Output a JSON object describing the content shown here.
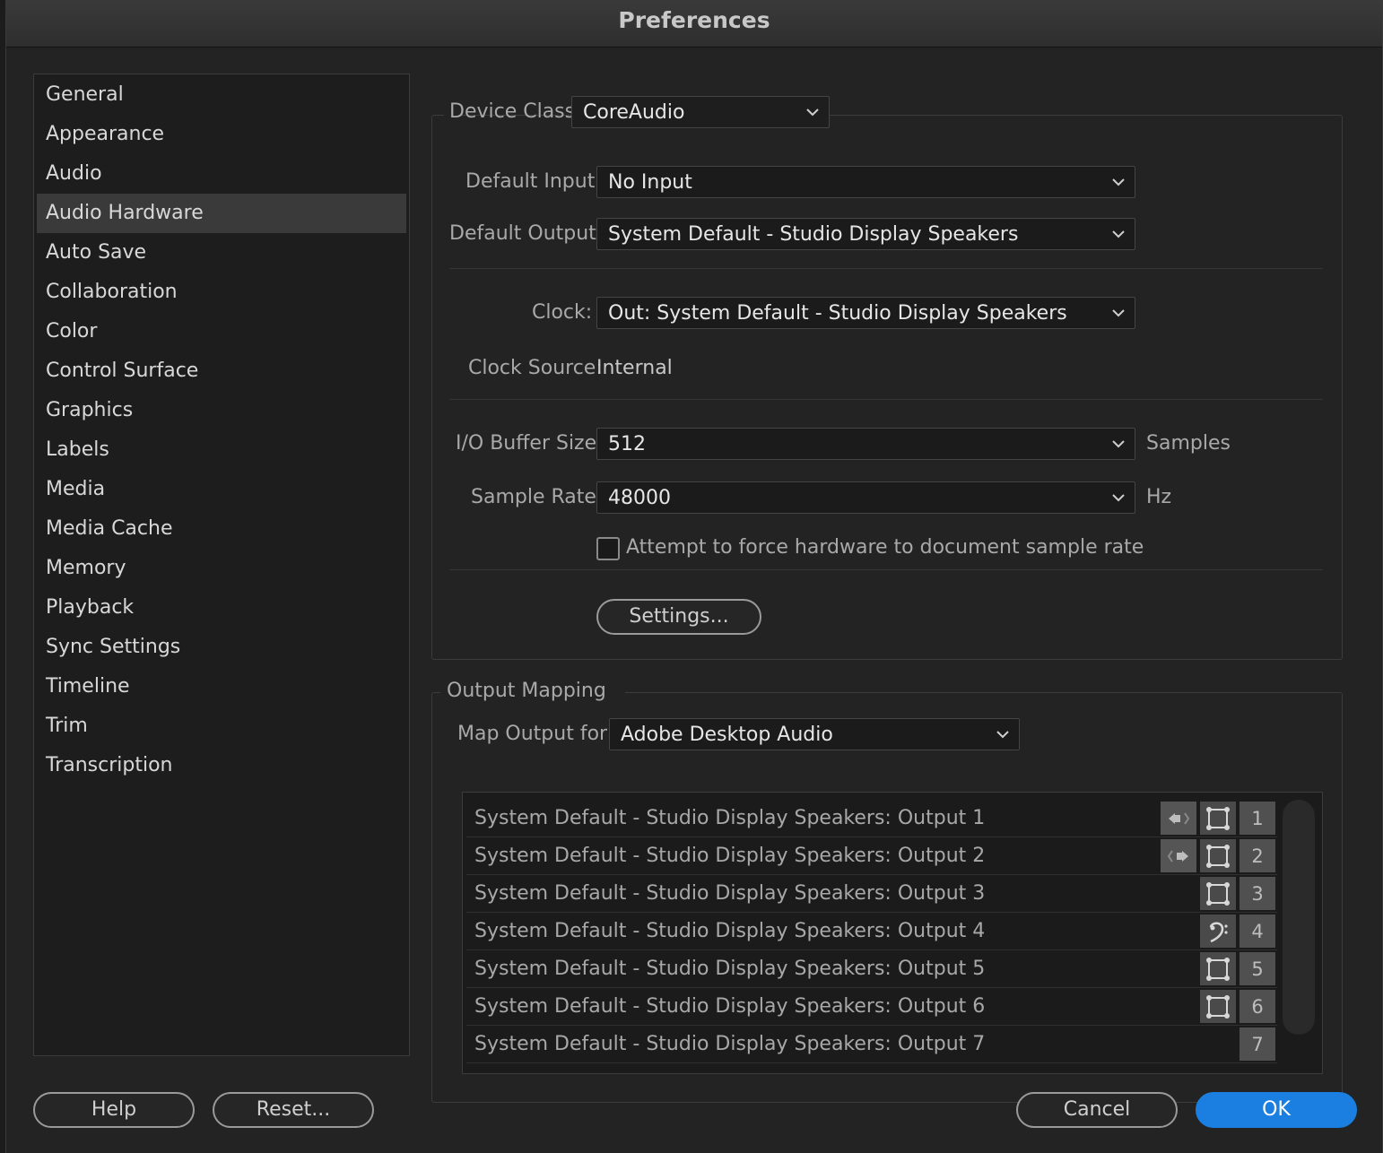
{
  "window": {
    "title": "Preferences"
  },
  "sidebar": {
    "items": [
      {
        "label": "General"
      },
      {
        "label": "Appearance"
      },
      {
        "label": "Audio"
      },
      {
        "label": "Audio Hardware",
        "selected": true
      },
      {
        "label": "Auto Save"
      },
      {
        "label": "Collaboration"
      },
      {
        "label": "Color"
      },
      {
        "label": "Control Surface"
      },
      {
        "label": "Graphics"
      },
      {
        "label": "Labels"
      },
      {
        "label": "Media"
      },
      {
        "label": "Media Cache"
      },
      {
        "label": "Memory"
      },
      {
        "label": "Playback"
      },
      {
        "label": "Sync Settings"
      },
      {
        "label": "Timeline"
      },
      {
        "label": "Trim"
      },
      {
        "label": "Transcription"
      }
    ]
  },
  "device": {
    "class_label": "Device Class:",
    "class_value": "CoreAudio",
    "default_input_label": "Default Input:",
    "default_input_value": "No Input",
    "default_output_label": "Default Output:",
    "default_output_value": "System Default - Studio Display Speakers",
    "clock_label": "Clock:",
    "clock_value": "Out: System Default - Studio Display Speakers",
    "clock_source_label": "Clock Source:",
    "clock_source_value": "Internal",
    "buffer_label": "I/O Buffer Size:",
    "buffer_value": "512",
    "buffer_unit": "Samples",
    "rate_label": "Sample Rate:",
    "rate_value": "48000",
    "rate_unit": "Hz",
    "force_rate_label": "Attempt to force hardware to document sample rate",
    "force_rate_checked": false,
    "settings_button": "Settings..."
  },
  "output_mapping": {
    "title": "Output Mapping",
    "map_for_label": "Map Output for:",
    "map_for_value": "Adobe Desktop Audio",
    "rows": [
      {
        "label": "System Default - Studio Display Speakers: Output 1",
        "channel": "1",
        "speaker_icon": "left-speaker-icon",
        "mono_icon": "mono-speaker-icon"
      },
      {
        "label": "System Default - Studio Display Speakers: Output 2",
        "channel": "2",
        "speaker_icon": "right-speaker-icon",
        "mono_icon": "mono-speaker-icon"
      },
      {
        "label": "System Default - Studio Display Speakers: Output 3",
        "channel": "3",
        "mono_icon": "mono-speaker-icon"
      },
      {
        "label": "System Default - Studio Display Speakers: Output 4",
        "channel": "4",
        "mono_icon": "lfe-bass-clef-icon"
      },
      {
        "label": "System Default - Studio Display Speakers: Output 5",
        "channel": "5",
        "mono_icon": "mono-speaker-icon"
      },
      {
        "label": "System Default - Studio Display Speakers: Output 6",
        "channel": "6",
        "mono_icon": "mono-speaker-icon"
      },
      {
        "label": "System Default - Studio Display Speakers: Output 7",
        "channel": "7"
      }
    ]
  },
  "footer": {
    "help": "Help",
    "reset": "Reset...",
    "cancel": "Cancel",
    "ok": "OK"
  },
  "colors": {
    "accent": "#1a7fe0",
    "window_bg": "#232323",
    "selected_bg": "#3a3a3a"
  }
}
